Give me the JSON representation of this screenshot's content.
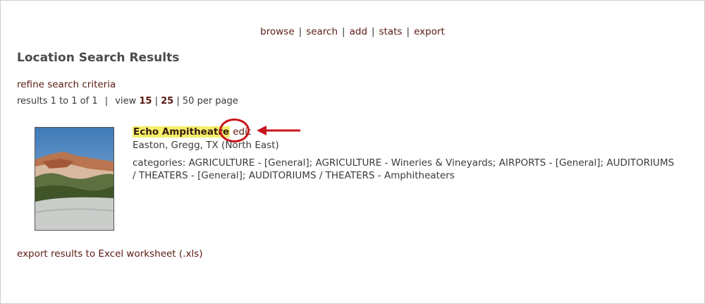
{
  "nav": {
    "items": [
      "browse",
      "search",
      "add",
      "stats",
      "export"
    ],
    "separator": "|"
  },
  "page_title": "Location Search Results",
  "refine_label": "refine search criteria",
  "results": {
    "summary": "results 1 to 1 of 1",
    "sep": "|",
    "view_label": "view",
    "per_page_15": "15",
    "per_page_25": "25",
    "per_page_50": "50 per page",
    "sep2": "|",
    "sep3": "|"
  },
  "result_item": {
    "name": "Echo Ampitheatre",
    "edit_label": "edit",
    "location": "Easton, Gregg, TX (North East)",
    "categories": "categories: AGRICULTURE - [General]; AGRICULTURE - Wineries & Vineyards; AIRPORTS - [General]; AUDITORIUMS / THEATERS - [General]; AUDITORIUMS / THEATERS - Amphitheaters"
  },
  "export_label": "export results to Excel worksheet (.xls)",
  "colors": {
    "link": "#5a1a12",
    "highlight": "#f3f06a",
    "annotation": "#c8141c"
  }
}
